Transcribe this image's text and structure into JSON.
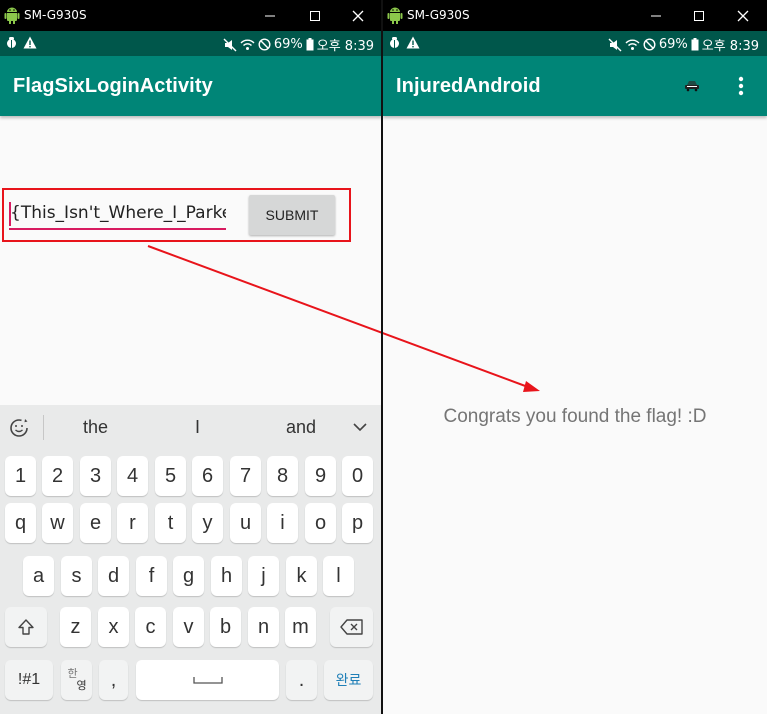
{
  "left": {
    "window_title": "SM-G930S",
    "status": {
      "battery": "69%",
      "time": "오후 8:39"
    },
    "app_title": "FlagSixLoginActivity",
    "input_value": "{This_Isn't_Where_I_Parke",
    "submit_label": "SUBMIT",
    "suggestions": [
      "the",
      "I",
      "and"
    ],
    "keyboard": {
      "row_numbers": [
        "1",
        "2",
        "3",
        "4",
        "5",
        "6",
        "7",
        "8",
        "9",
        "0"
      ],
      "row_top": [
        "q",
        "w",
        "e",
        "r",
        "t",
        "y",
        "u",
        "i",
        "o",
        "p"
      ],
      "row_middle": [
        "a",
        "s",
        "d",
        "f",
        "g",
        "h",
        "j",
        "k",
        "l"
      ],
      "row_bottom": [
        "z",
        "x",
        "c",
        "v",
        "b",
        "n",
        "m"
      ],
      "symbols_key": "!#1",
      "lang_key_top": "한",
      "lang_key_bottom": "영",
      "comma_key": ",",
      "period_key": ".",
      "done_key": "완료"
    }
  },
  "right": {
    "window_title": "SM-G930S",
    "status": {
      "battery": "69%",
      "time": "오후 8:39"
    },
    "app_title": "InjuredAndroid",
    "message": "Congrats you found the flag! :D"
  },
  "colors": {
    "appbar": "#008577",
    "statusbar": "#00574b",
    "accent": "#d81b60",
    "highlight": "#e8141b"
  }
}
